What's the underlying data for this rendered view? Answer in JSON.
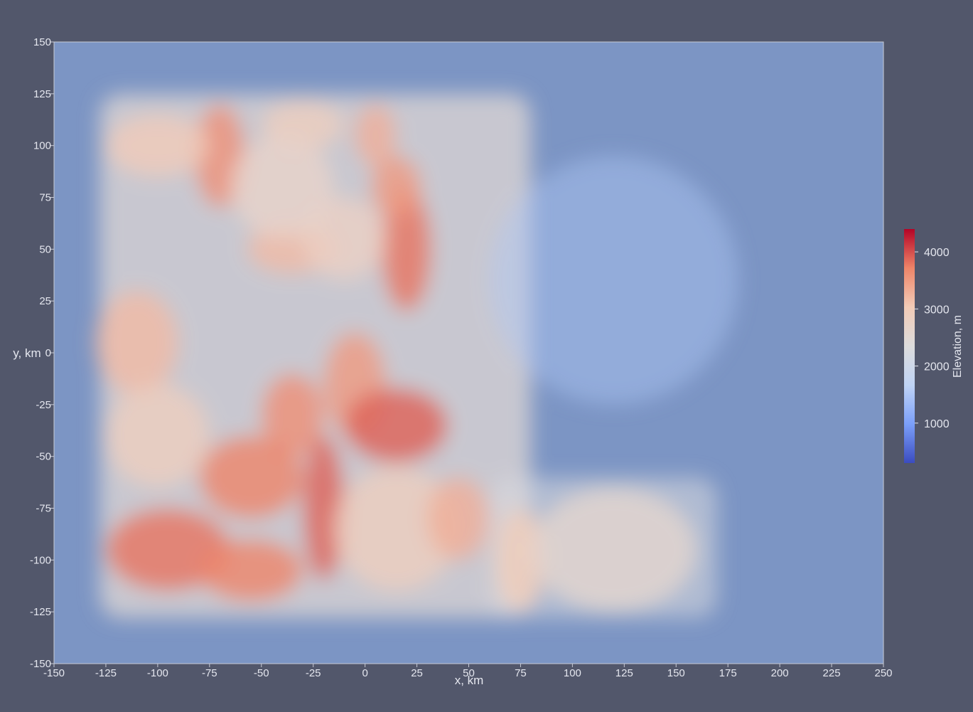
{
  "chart_data": {
    "type": "heatmap",
    "title": "",
    "xlabel": "x, km",
    "ylabel": "y, km",
    "xlim": [
      -150,
      250
    ],
    "ylim": [
      -150,
      150
    ],
    "x_ticks": [
      -150,
      -125,
      -100,
      -75,
      -50,
      -25,
      0,
      25,
      50,
      75,
      100,
      125,
      150,
      175,
      200,
      225,
      250
    ],
    "y_ticks": [
      150,
      125,
      100,
      75,
      50,
      25,
      0,
      -25,
      -50,
      -75,
      -100,
      -125,
      -150
    ],
    "colorbar": {
      "title": "Elevation, m",
      "range": [
        300,
        4400
      ],
      "ticks": [
        4000,
        3000,
        2000,
        1000
      ],
      "colormap": "coolwarm",
      "colors": [
        "#3b4cc0",
        "#7b9ff9",
        "#c0d4f5",
        "#dddcdc",
        "#f2cbb7",
        "#ee8468",
        "#b40426"
      ]
    },
    "background_color": "#52576b",
    "field_background_color": "#7c95c4",
    "terrain_regions": [
      {
        "x": -70,
        "y": 95,
        "rx": 12,
        "ry": 25,
        "elevation": 3600
      },
      {
        "x": -100,
        "y": 100,
        "rx": 25,
        "ry": 15,
        "elevation": 3000
      },
      {
        "x": -30,
        "y": 110,
        "rx": 20,
        "ry": 12,
        "elevation": 2900
      },
      {
        "x": 5,
        "y": 105,
        "rx": 10,
        "ry": 15,
        "elevation": 3300
      },
      {
        "x": 20,
        "y": 50,
        "rx": 12,
        "ry": 30,
        "elevation": 3800
      },
      {
        "x": 15,
        "y": 80,
        "rx": 12,
        "ry": 15,
        "elevation": 3500
      },
      {
        "x": -35,
        "y": 50,
        "rx": 22,
        "ry": 12,
        "elevation": 3200
      },
      {
        "x": -110,
        "y": 5,
        "rx": 20,
        "ry": 25,
        "elevation": 3200
      },
      {
        "x": -5,
        "y": -15,
        "rx": 15,
        "ry": 25,
        "elevation": 3500
      },
      {
        "x": 15,
        "y": -35,
        "rx": 25,
        "ry": 18,
        "elevation": 3900
      },
      {
        "x": -35,
        "y": -30,
        "rx": 15,
        "ry": 20,
        "elevation": 3600
      },
      {
        "x": -20,
        "y": -75,
        "rx": 10,
        "ry": 35,
        "elevation": 3900
      },
      {
        "x": -55,
        "y": -60,
        "rx": 25,
        "ry": 20,
        "elevation": 3700
      },
      {
        "x": -95,
        "y": -95,
        "rx": 30,
        "ry": 20,
        "elevation": 3800
      },
      {
        "x": -55,
        "y": -105,
        "rx": 25,
        "ry": 15,
        "elevation": 3700
      },
      {
        "x": 15,
        "y": -85,
        "rx": 30,
        "ry": 30,
        "elevation": 2900
      },
      {
        "x": 45,
        "y": -80,
        "rx": 15,
        "ry": 20,
        "elevation": 3300
      },
      {
        "x": 75,
        "y": -100,
        "rx": 12,
        "ry": 25,
        "elevation": 3000
      },
      {
        "x": 120,
        "y": -95,
        "rx": 40,
        "ry": 30,
        "elevation": 2600
      },
      {
        "x": -100,
        "y": -40,
        "rx": 25,
        "ry": 25,
        "elevation": 2900
      },
      {
        "x": -10,
        "y": 55,
        "rx": 20,
        "ry": 20,
        "elevation": 2800
      },
      {
        "x": -40,
        "y": 80,
        "rx": 25,
        "ry": 25,
        "elevation": 2700
      }
    ],
    "low_regions": [
      {
        "x": 120,
        "y": 35,
        "rx": 60,
        "ry": 60,
        "elevation": 1500
      }
    ]
  }
}
